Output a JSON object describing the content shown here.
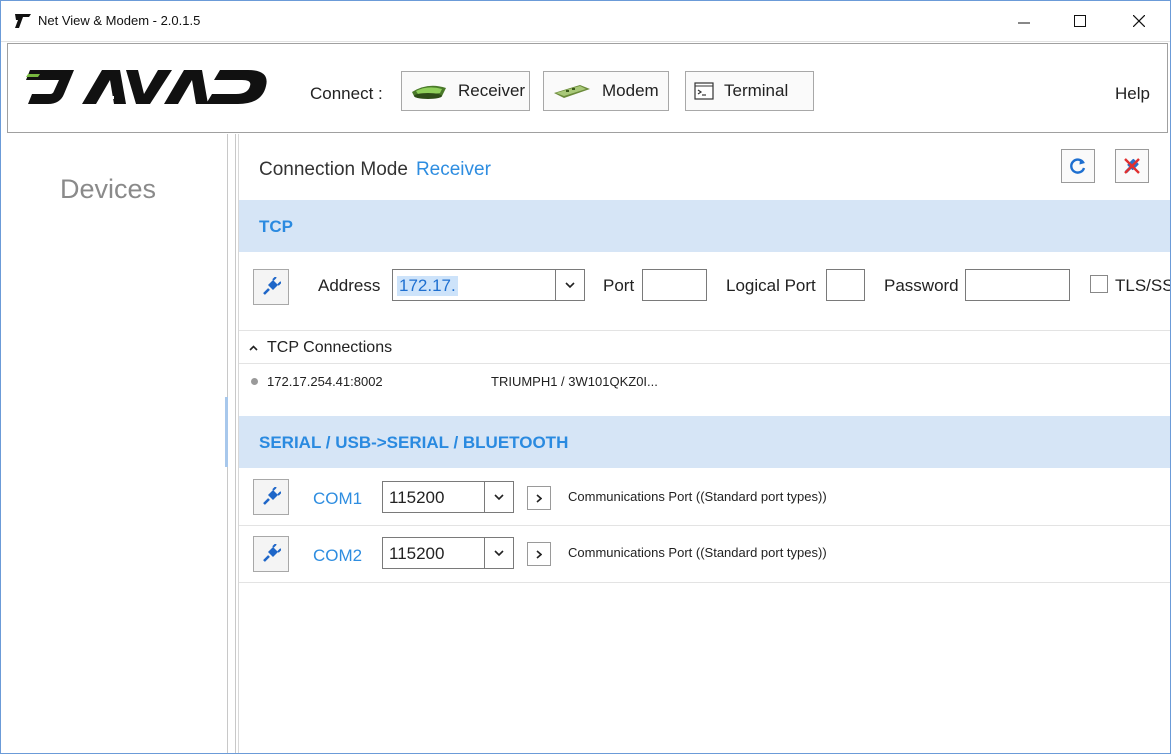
{
  "window": {
    "title": "Net View & Modem -  2.0.1.5"
  },
  "toolbar": {
    "logo_text": "JAVAD",
    "connect_label": "Connect :",
    "receiver_label": "Receiver",
    "modem_label": "Modem",
    "terminal_label": "Terminal",
    "help_label": "Help"
  },
  "sidebar": {
    "heading": "Devices"
  },
  "main": {
    "connection_mode_label": "Connection Mode",
    "connection_mode_value": "Receiver",
    "tcp": {
      "header": "TCP",
      "address_label": "Address",
      "address_value": "172.17.",
      "port_label": "Port",
      "logical_port_label": "Logical Port",
      "password_label": "Password",
      "tls_label": "TLS/SS",
      "connections_header": "TCP Connections",
      "connections": [
        {
          "address": "172.17.254.41:8002",
          "device": "TRIUMPH1 / 3W101QKZ0I..."
        }
      ]
    },
    "serial": {
      "header": "SERIAL / USB->SERIAL / BLUETOOTH",
      "ports": [
        {
          "name": "COM1",
          "baud": "115200",
          "desc": "Communications Port  ((Standard port types))"
        },
        {
          "name": "COM2",
          "baud": "115200",
          "desc": "Communications Port  ((Standard port types))"
        }
      ]
    }
  },
  "colors": {
    "accent": "#2e8de0",
    "section_bg": "#d6e5f6",
    "window_border": "#6b9bd8"
  }
}
